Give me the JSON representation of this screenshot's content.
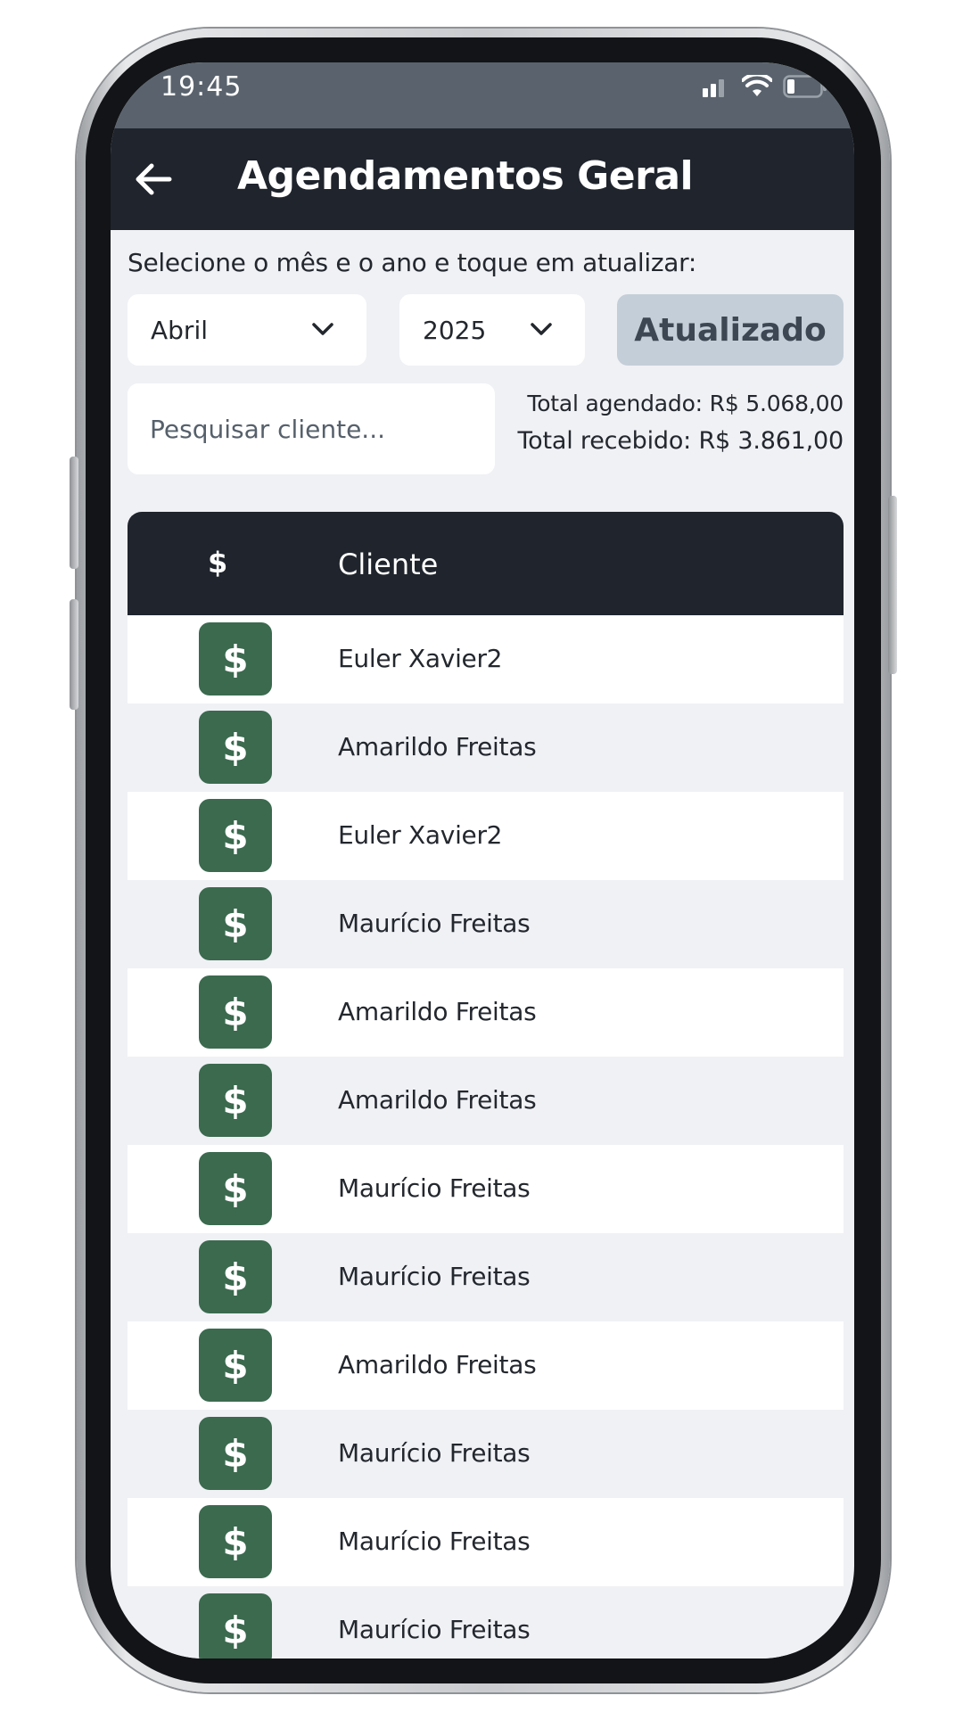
{
  "status_bar": {
    "time": "19:45",
    "icons": [
      "signal-icon",
      "wifi-icon",
      "battery-icon"
    ]
  },
  "header": {
    "back_icon": "arrow-left-icon",
    "title": "Agendamentos Geral"
  },
  "filters": {
    "instruction": "Selecione o mês e o ano e toque em atualizar:",
    "month": "Abril",
    "year": "2025",
    "update_label": "Atualizado"
  },
  "search": {
    "placeholder": "Pesquisar cliente..."
  },
  "totals": {
    "scheduled": "Total agendado: R$ 5.068,00",
    "received": "Total recebido: R$ 3.861,00"
  },
  "table": {
    "columns": [
      "$",
      "Cliente"
    ],
    "rows": [
      {
        "icon": "$",
        "client": "Euler Xavier2"
      },
      {
        "icon": "$",
        "client": "Amarildo Freitas"
      },
      {
        "icon": "$",
        "client": "Euler Xavier2"
      },
      {
        "icon": "$",
        "client": "Maurício Freitas"
      },
      {
        "icon": "$",
        "client": "Amarildo Freitas"
      },
      {
        "icon": "$",
        "client": "Amarildo Freitas"
      },
      {
        "icon": "$",
        "client": "Maurício Freitas"
      },
      {
        "icon": "$",
        "client": "Maurício Freitas"
      },
      {
        "icon": "$",
        "client": "Amarildo Freitas"
      },
      {
        "icon": "$",
        "client": "Maurício Freitas"
      },
      {
        "icon": "$",
        "client": "Maurício Freitas"
      },
      {
        "icon": "$",
        "client": "Maurício Freitas"
      }
    ]
  },
  "colors": {
    "header_bg": "#1f242d",
    "status_bg": "#5a636d",
    "pay_button": "#3b6a4f",
    "update_button": "#c4ced8",
    "page_bg": "#f0f1f5"
  }
}
